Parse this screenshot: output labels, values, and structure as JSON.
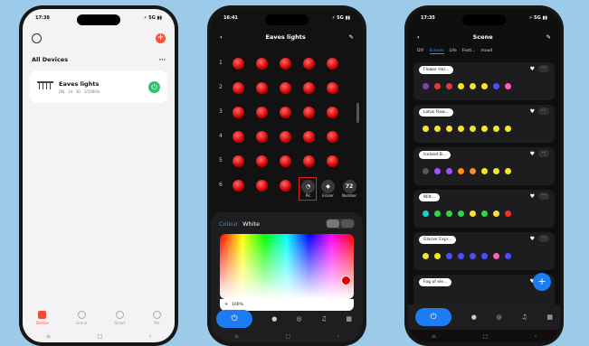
{
  "phone1": {
    "status_time": "17:38",
    "status_right": "⚡ 5G ▮▮",
    "section_title": "All Devices",
    "section_more": "···",
    "device": {
      "name": "Eaves lights",
      "sub": "ON · 1d · 30 · 1/1000lx"
    },
    "tabs": [
      {
        "label": "Device"
      },
      {
        "label": "Scene"
      },
      {
        "label": "Smart"
      },
      {
        "label": "Me"
      }
    ]
  },
  "phone2": {
    "status_time": "16:41",
    "status_right": "⚡ 5G ▮▮",
    "title": "Eaves lights",
    "row_numbers": [
      "1",
      "2",
      "3",
      "4",
      "5",
      "6"
    ],
    "tools": [
      {
        "label": "Pic",
        "glyph": "◔"
      },
      {
        "label": "Eraser",
        "glyph": "◆"
      },
      {
        "label": "Number",
        "glyph": "72"
      }
    ],
    "colour_label": "Colour",
    "colour_value": "White",
    "brightness": "100%",
    "accent": "#1e7cf2"
  },
  "phone3": {
    "status_time": "17:35",
    "status_right": "⚡ 5G ▮▮",
    "title": "Scene",
    "tabs": [
      "DIY",
      "Scenes",
      "Life",
      "Festi...",
      "mood"
    ],
    "scenes": [
      {
        "name": "Flower Har...",
        "colors": [
          "#7e3fbf",
          "#e23b3b",
          "#e23b3b",
          "#f5e62a",
          "#f5e62a",
          "#f5e62a",
          "#4c4cff",
          "#ff5fb4"
        ]
      },
      {
        "name": "Lotus Flow...",
        "colors": [
          "#f5e62a",
          "#f5e62a",
          "#f5e62a",
          "#f5e62a",
          "#f5e62a",
          "#f5e62a",
          "#f5e62a",
          "#f5e62a"
        ]
      },
      {
        "name": "Iceland B...",
        "colors": [
          "#555555",
          "#a64dff",
          "#a64dff",
          "#ff8a1f",
          "#ff8a1f",
          "#f5e62a",
          "#f5e62a",
          "#f5e62a"
        ]
      },
      {
        "name": "Wilt...",
        "colors": [
          "#18d0d0",
          "#2ad84a",
          "#2ad84a",
          "#2ad84a",
          "#f5e62a",
          "#2ad84a",
          "#f5e62a",
          "#ff2a2a"
        ]
      },
      {
        "name": "Glacier Expr...",
        "colors": [
          "#f5e62a",
          "#f5e62a",
          "#4c4cff",
          "#4c4cff",
          "#4c4cff",
          "#4c4cff",
          "#ff5fb4",
          "#4c4cff"
        ]
      },
      {
        "name": "Fog of ele...",
        "colors": []
      }
    ]
  }
}
